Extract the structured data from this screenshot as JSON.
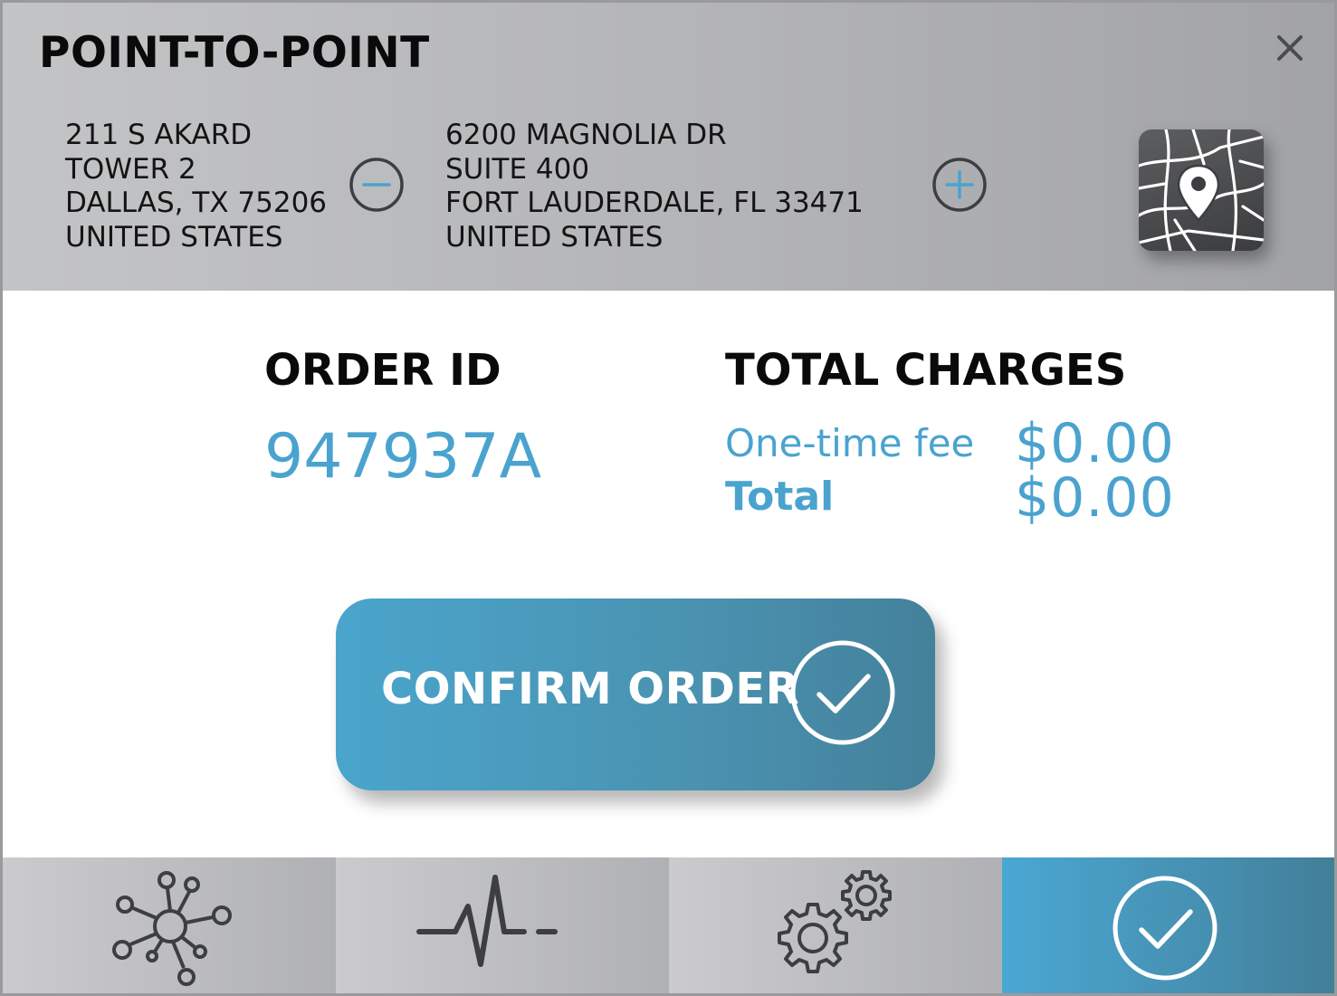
{
  "header": {
    "title": "POINT-TO-POINT",
    "close_icon": "close-icon",
    "address_a": {
      "line1": "211 S AKARD",
      "line2": "TOWER 2",
      "line3": "DALLAS, TX 75206",
      "line4": "UNITED STATES"
    },
    "address_b": {
      "line1": "6200 MAGNOLIA DR",
      "line2": "SUITE 400",
      "line3": "FORT LAUDERDALE, FL 33471",
      "line4": "UNITED STATES"
    },
    "remove_icon": "minus-circle-icon",
    "add_icon": "plus-circle-icon",
    "map_icon": "map-pin-icon"
  },
  "order": {
    "id_label": "ORDER ID",
    "id_value": "947937A"
  },
  "charges": {
    "label": "TOTAL CHARGES",
    "fee_label": "One-time fee",
    "fee_value": "$0.00",
    "total_label": "Total",
    "total_value": "$0.00"
  },
  "confirm": {
    "label": "CONFIRM ORDER",
    "icon": "check-circle-icon"
  },
  "nav": {
    "items": [
      {
        "icon": "network-icon",
        "selected": false
      },
      {
        "icon": "pulse-icon",
        "selected": false
      },
      {
        "icon": "gears-icon",
        "selected": false
      },
      {
        "icon": "check-circle-icon",
        "selected": true
      }
    ]
  },
  "colors": {
    "accent": "#4aa3cf",
    "header_bg": "#b3b4b7",
    "icon_dark": "#3c3e42",
    "text": "#111111"
  }
}
